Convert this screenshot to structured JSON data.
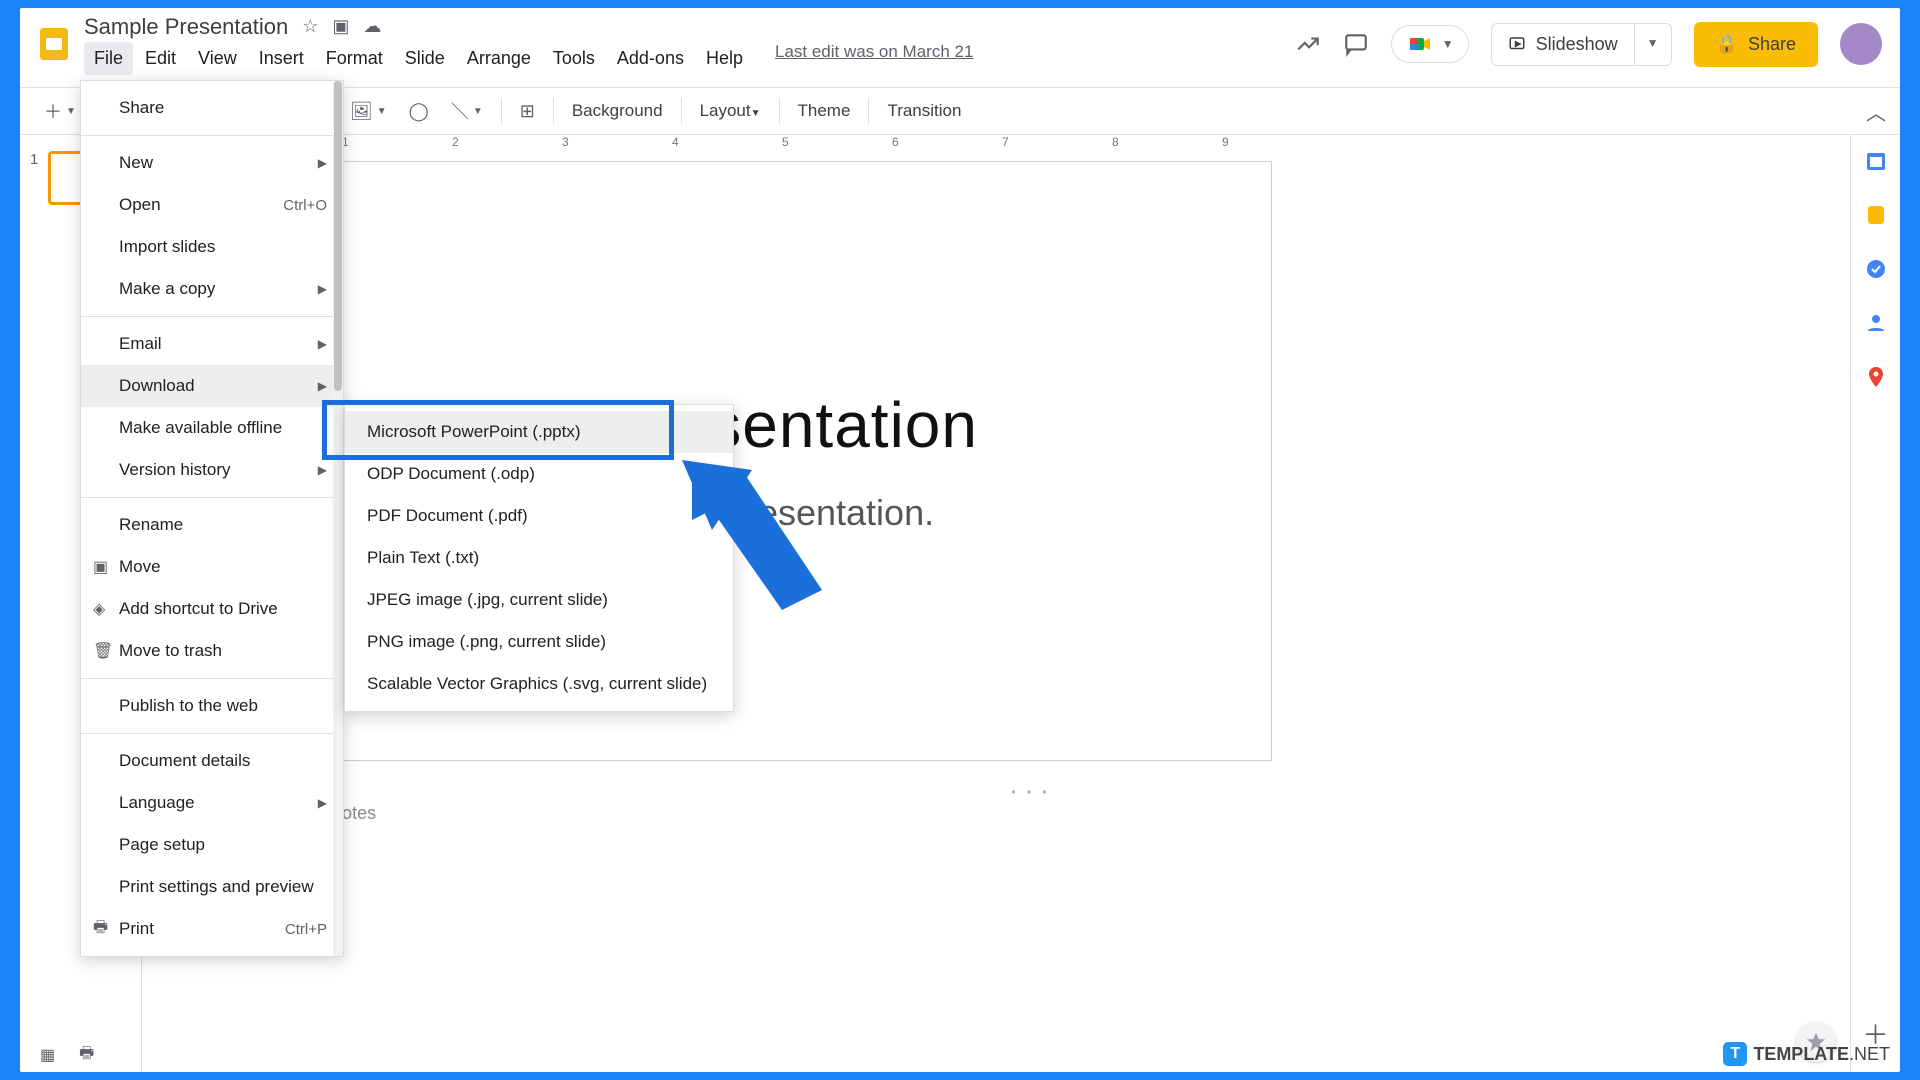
{
  "doc": {
    "title": "Sample Presentation",
    "last_edit": "Last edit was on March 21"
  },
  "menubar": [
    "File",
    "Edit",
    "View",
    "Insert",
    "Format",
    "Slide",
    "Arrange",
    "Tools",
    "Add-ons",
    "Help"
  ],
  "right": {
    "slideshow": "Slideshow",
    "share": "Share"
  },
  "toolbar": {
    "background": "Background",
    "layout": "Layout",
    "theme": "Theme",
    "transition": "Transition"
  },
  "ruler": [
    "1",
    "2",
    "3",
    "4",
    "5",
    "6",
    "7",
    "8",
    "9"
  ],
  "thumbnail": {
    "num": "1"
  },
  "slide": {
    "title": "le Presentation",
    "subtitle": "a s  mple presentation."
  },
  "notes": {
    "placeholder": "d speaker notes"
  },
  "file_menu": {
    "share": "Share",
    "new": "New",
    "open": "Open",
    "open_shortcut": "Ctrl+O",
    "import": "Import slides",
    "copy": "Make a copy",
    "email": "Email",
    "download": "Download",
    "offline": "Make available offline",
    "version": "Version history",
    "rename": "Rename",
    "move": "Move",
    "shortcut": "Add shortcut to Drive",
    "trash": "Move to trash",
    "publish": "Publish to the web",
    "details": "Document details",
    "language": "Language",
    "pagesetup": "Page setup",
    "printsettings": "Print settings and preview",
    "print": "Print",
    "print_shortcut": "Ctrl+P"
  },
  "download_menu": {
    "pptx": "Microsoft PowerPoint (.pptx)",
    "odp": "ODP Document (.odp)",
    "pdf": "PDF Document (.pdf)",
    "txt": "Plain Text (.txt)",
    "jpeg": "JPEG image (.jpg, current slide)",
    "png": "PNG image (.png, current slide)",
    "svg": "Scalable Vector Graphics (.svg, current slide)"
  },
  "watermark": {
    "brand_bold": "TEMPLATE",
    "brand_light": ".NET"
  }
}
